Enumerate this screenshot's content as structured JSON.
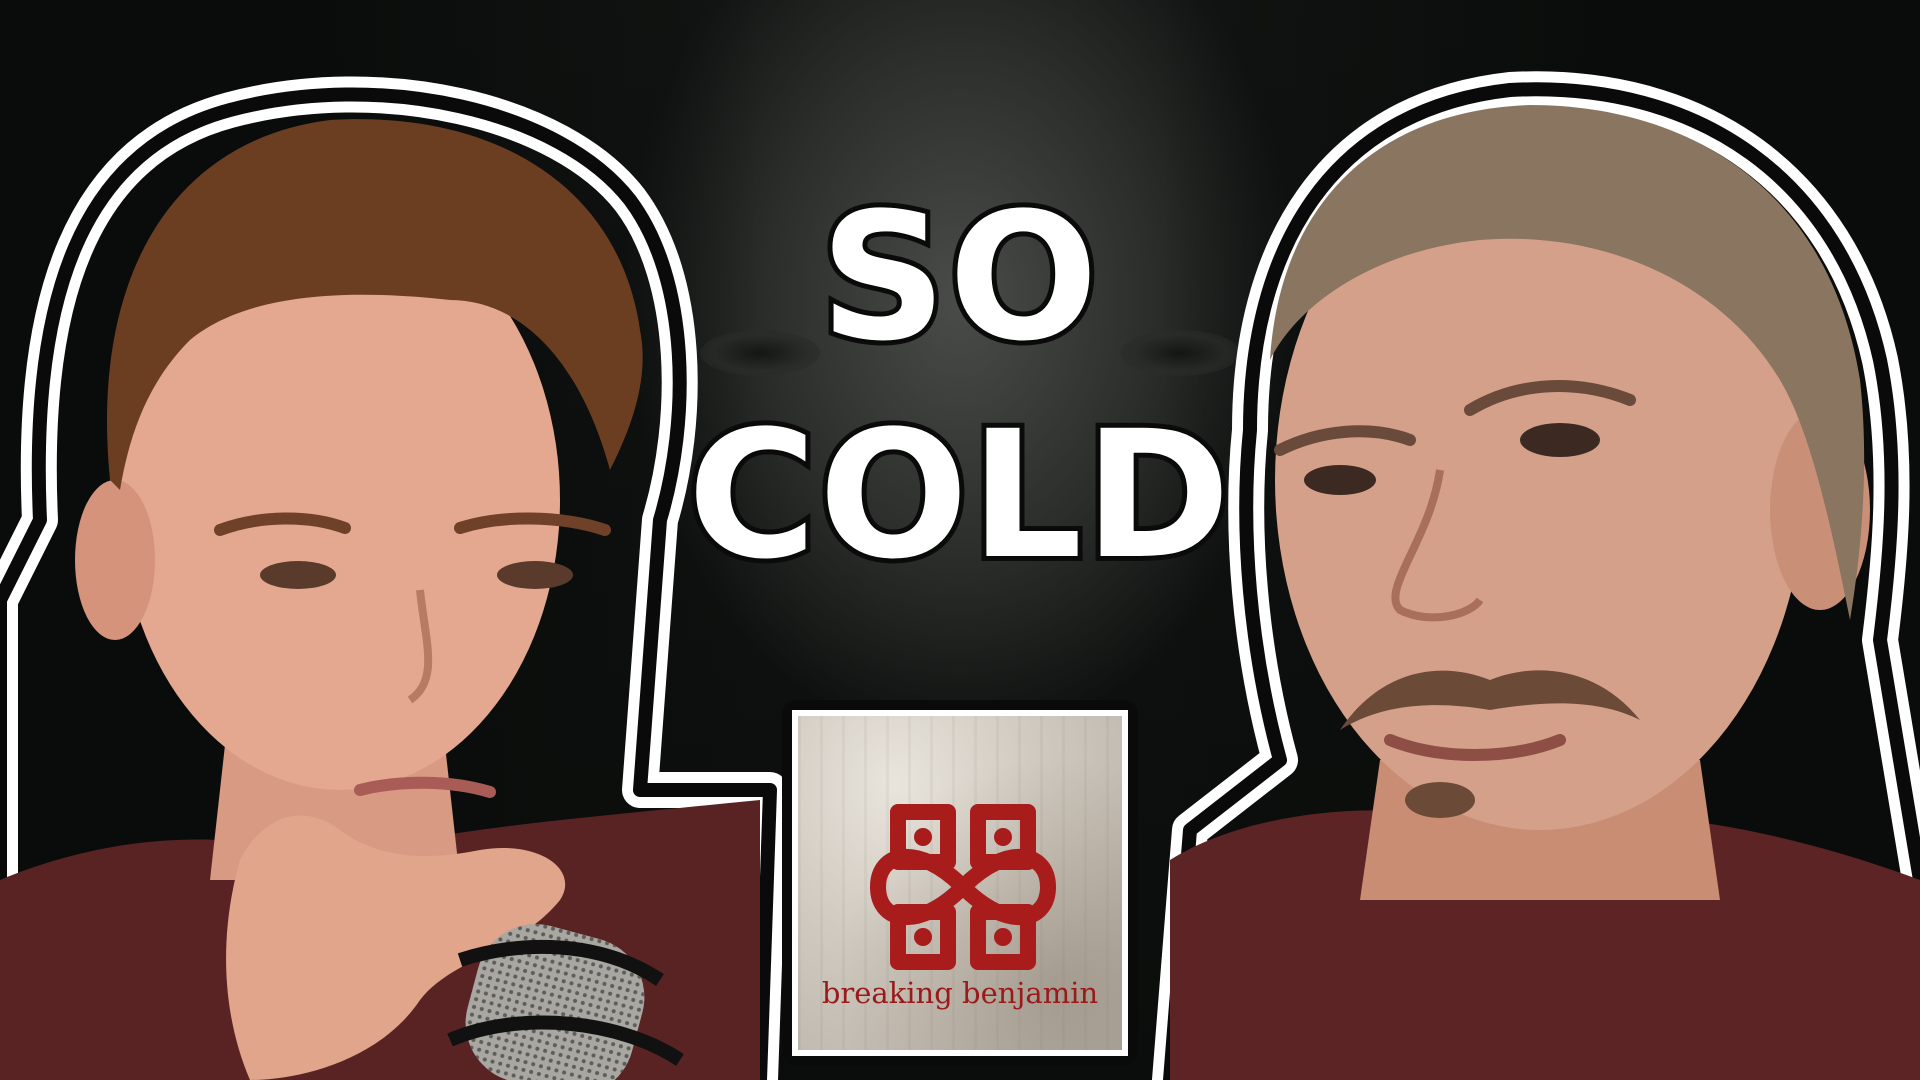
{
  "thumbnail": {
    "title_line_1": "SO",
    "title_line_2": "COLD",
    "album": {
      "band_name": "breaking benjamin",
      "logo": "celtic-heart-knot-icon"
    }
  },
  "colors": {
    "title_fill": "#ffffff",
    "title_outline": "#0b0b0b",
    "album_logo_red": "#a81c1c",
    "shirt_maroon": "#5a2323",
    "background_dark": "#0c0f0d"
  }
}
